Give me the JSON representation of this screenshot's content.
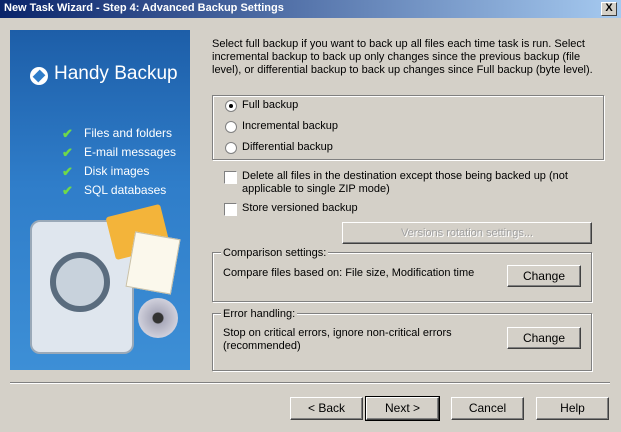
{
  "window": {
    "title": "New Task Wizard - Step 4: Advanced Backup Settings",
    "close": "X"
  },
  "banner": {
    "brand": "Handy Backup",
    "features": [
      "Files and folders",
      "E-mail messages",
      "Disk images",
      "SQL databases"
    ]
  },
  "description": "Select full backup if you want to back up all files each time task is run. Select incremental backup to back up only changes since the previous backup (file level), or differential backup to back up changes since Full backup (byte level).",
  "backup_type": {
    "options": [
      "Full backup",
      "Incremental backup",
      "Differential backup"
    ],
    "selected": "Full backup"
  },
  "options": {
    "delete_label": "Delete all files in the destination except those being backed up (not applicable to single ZIP mode)",
    "versioned_label": "Store versioned backup",
    "versions_button": "Versions rotation settings..."
  },
  "comparison": {
    "title": "Comparison settings:",
    "text": "Compare files based on: File size, Modification time",
    "button": "Change"
  },
  "error_handling": {
    "title": "Error handling:",
    "text": "Stop on critical errors, ignore non-critical errors (recommended)",
    "button": "Change"
  },
  "footer": {
    "back": "< Back",
    "next": "Next >",
    "cancel": "Cancel",
    "help": "Help"
  }
}
